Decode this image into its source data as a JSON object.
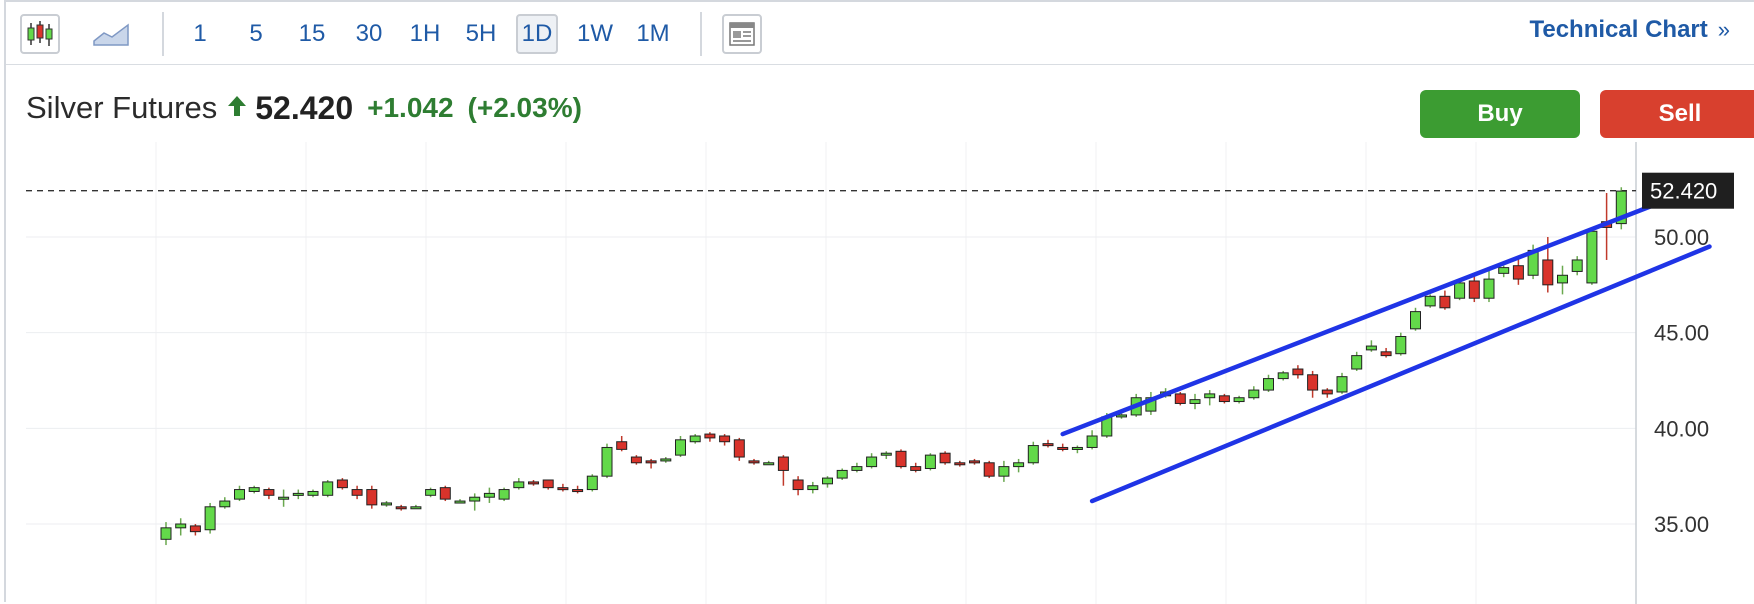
{
  "toolbar": {
    "intervals": [
      "1",
      "5",
      "15",
      "30",
      "1H",
      "5H",
      "1D",
      "1W",
      "1M"
    ],
    "active_interval": "1D",
    "technical_chart_label": "Technical Chart",
    "technical_chart_chevron": "»"
  },
  "quote": {
    "name": "Silver Futures",
    "price": "52.420",
    "change": "+1.042",
    "change_pct": "(+2.03%)",
    "up_color": "#2e7d32"
  },
  "actions": {
    "buy_label": "Buy",
    "sell_label": "Sell",
    "buy_color": "#3c9c32",
    "sell_color": "#d8402e"
  },
  "chart_data": {
    "type": "candlestick",
    "price_axis": {
      "ticks": [
        "35.00",
        "40.00",
        "45.00",
        "50.00"
      ],
      "visible_range": [
        34.0,
        55.0
      ]
    },
    "last_price": 52.42,
    "last_price_label": "52.420",
    "up_color": "#63d94a",
    "down_color": "#d9332b",
    "candles": [
      [
        34.2,
        35.1,
        33.9,
        34.8
      ],
      [
        34.8,
        35.3,
        34.4,
        35.0
      ],
      [
        34.9,
        35.0,
        34.4,
        34.6
      ],
      [
        34.7,
        36.1,
        34.5,
        35.9
      ],
      [
        35.9,
        36.4,
        35.8,
        36.2
      ],
      [
        36.3,
        37.0,
        36.2,
        36.8
      ],
      [
        36.7,
        37.0,
        36.6,
        36.9
      ],
      [
        36.8,
        36.9,
        36.3,
        36.5
      ],
      [
        36.4,
        36.8,
        35.9,
        36.4
      ],
      [
        36.5,
        36.8,
        36.3,
        36.6
      ],
      [
        36.5,
        36.8,
        36.4,
        36.7
      ],
      [
        36.5,
        37.3,
        36.4,
        37.2
      ],
      [
        37.3,
        37.4,
        36.8,
        36.9
      ],
      [
        36.8,
        37.0,
        36.3,
        36.5
      ],
      [
        36.8,
        37.0,
        35.8,
        36.0
      ],
      [
        36.0,
        36.2,
        35.9,
        36.1
      ],
      [
        35.9,
        36.0,
        35.7,
        35.8
      ],
      [
        35.9,
        36.0,
        35.8,
        35.9
      ],
      [
        36.5,
        36.9,
        36.4,
        36.8
      ],
      [
        36.9,
        37.0,
        36.2,
        36.3
      ],
      [
        36.2,
        36.3,
        36.1,
        36.2
      ],
      [
        36.2,
        36.6,
        35.7,
        36.4
      ],
      [
        36.4,
        36.9,
        36.1,
        36.6
      ],
      [
        36.3,
        36.9,
        36.2,
        36.8
      ],
      [
        36.9,
        37.4,
        36.8,
        37.2
      ],
      [
        37.2,
        37.3,
        37.0,
        37.1
      ],
      [
        37.3,
        37.3,
        36.8,
        36.9
      ],
      [
        36.9,
        37.1,
        36.7,
        36.8
      ],
      [
        36.8,
        37.0,
        36.6,
        36.7
      ],
      [
        36.8,
        37.6,
        36.7,
        37.5
      ],
      [
        37.5,
        39.2,
        37.4,
        39.0
      ],
      [
        39.3,
        39.6,
        38.8,
        38.9
      ],
      [
        38.5,
        38.6,
        38.1,
        38.2
      ],
      [
        38.3,
        38.4,
        37.9,
        38.2
      ],
      [
        38.3,
        38.5,
        38.2,
        38.4
      ],
      [
        38.6,
        39.6,
        38.5,
        39.4
      ],
      [
        39.3,
        39.7,
        39.2,
        39.6
      ],
      [
        39.7,
        39.8,
        39.3,
        39.5
      ],
      [
        39.6,
        39.7,
        39.1,
        39.3
      ],
      [
        39.4,
        39.5,
        38.3,
        38.5
      ],
      [
        38.3,
        38.4,
        38.1,
        38.2
      ],
      [
        38.2,
        38.3,
        38.1,
        38.2
      ],
      [
        38.5,
        38.6,
        37.0,
        37.8
      ],
      [
        37.3,
        37.5,
        36.5,
        36.8
      ],
      [
        36.8,
        37.2,
        36.6,
        37.0
      ],
      [
        37.1,
        37.5,
        36.9,
        37.4
      ],
      [
        37.4,
        37.9,
        37.3,
        37.8
      ],
      [
        37.8,
        38.2,
        37.7,
        38.0
      ],
      [
        38.0,
        38.7,
        37.9,
        38.5
      ],
      [
        38.6,
        38.8,
        38.4,
        38.7
      ],
      [
        38.8,
        38.9,
        37.9,
        38.0
      ],
      [
        38.0,
        38.2,
        37.7,
        37.8
      ],
      [
        37.9,
        38.7,
        37.8,
        38.6
      ],
      [
        38.7,
        38.8,
        38.1,
        38.2
      ],
      [
        38.2,
        38.3,
        38.0,
        38.1
      ],
      [
        38.3,
        38.4,
        38.1,
        38.2
      ],
      [
        38.2,
        38.3,
        37.4,
        37.5
      ],
      [
        37.5,
        38.3,
        37.2,
        38.0
      ],
      [
        38.0,
        38.4,
        37.7,
        38.2
      ],
      [
        38.2,
        39.3,
        38.1,
        39.1
      ],
      [
        39.2,
        39.4,
        39.0,
        39.1
      ],
      [
        39.0,
        39.2,
        38.8,
        38.9
      ],
      [
        38.9,
        39.1,
        38.7,
        39.0
      ],
      [
        39.0,
        39.9,
        38.9,
        39.6
      ],
      [
        39.6,
        40.8,
        39.5,
        40.6
      ],
      [
        40.6,
        40.8,
        40.5,
        40.7
      ],
      [
        40.7,
        41.8,
        40.6,
        41.6
      ],
      [
        40.9,
        41.9,
        40.7,
        41.6
      ],
      [
        41.7,
        42.1,
        41.6,
        41.9
      ],
      [
        41.8,
        41.9,
        41.2,
        41.3
      ],
      [
        41.3,
        41.8,
        41.0,
        41.5
      ],
      [
        41.6,
        42.0,
        41.2,
        41.8
      ],
      [
        41.7,
        41.8,
        41.3,
        41.4
      ],
      [
        41.4,
        41.7,
        41.3,
        41.6
      ],
      [
        41.6,
        42.2,
        41.5,
        42.0
      ],
      [
        42.0,
        42.8,
        41.9,
        42.6
      ],
      [
        42.6,
        43.0,
        42.5,
        42.9
      ],
      [
        43.1,
        43.3,
        42.6,
        42.8
      ],
      [
        42.8,
        43.0,
        41.6,
        42.0
      ],
      [
        42.0,
        42.1,
        41.6,
        41.8
      ],
      [
        41.9,
        42.9,
        41.8,
        42.7
      ],
      [
        43.1,
        44.0,
        43.0,
        43.8
      ],
      [
        44.1,
        44.6,
        44.0,
        44.3
      ],
      [
        44.0,
        44.2,
        43.7,
        43.8
      ],
      [
        43.9,
        45.0,
        43.8,
        44.8
      ],
      [
        45.2,
        46.3,
        45.1,
        46.1
      ],
      [
        46.4,
        47.0,
        46.3,
        46.9
      ],
      [
        46.9,
        47.2,
        46.2,
        46.3
      ],
      [
        46.8,
        47.8,
        46.7,
        47.6
      ],
      [
        47.7,
        48.1,
        46.6,
        46.8
      ],
      [
        46.8,
        48.3,
        46.6,
        47.8
      ],
      [
        48.1,
        48.5,
        47.9,
        48.4
      ],
      [
        48.5,
        49.0,
        47.5,
        47.8
      ],
      [
        48.0,
        49.6,
        47.8,
        49.3
      ],
      [
        48.8,
        50.0,
        47.1,
        47.5
      ],
      [
        47.6,
        48.5,
        47.0,
        48.0
      ],
      [
        48.2,
        49.0,
        48.0,
        48.8
      ],
      [
        47.6,
        50.4,
        47.5,
        50.3
      ],
      [
        50.8,
        52.3,
        48.8,
        50.5
      ],
      [
        50.7,
        52.6,
        50.4,
        52.4
      ]
    ],
    "trend_channel": {
      "upper": {
        "from": {
          "candle": 61,
          "price": 39.7
        },
        "to": {
          "candle": 103,
          "price": 52.2
        }
      },
      "lower": {
        "from": {
          "candle": 63,
          "price": 36.2
        },
        "to": {
          "candle": 105,
          "price": 49.5
        }
      },
      "color": "#1f34e6"
    }
  }
}
